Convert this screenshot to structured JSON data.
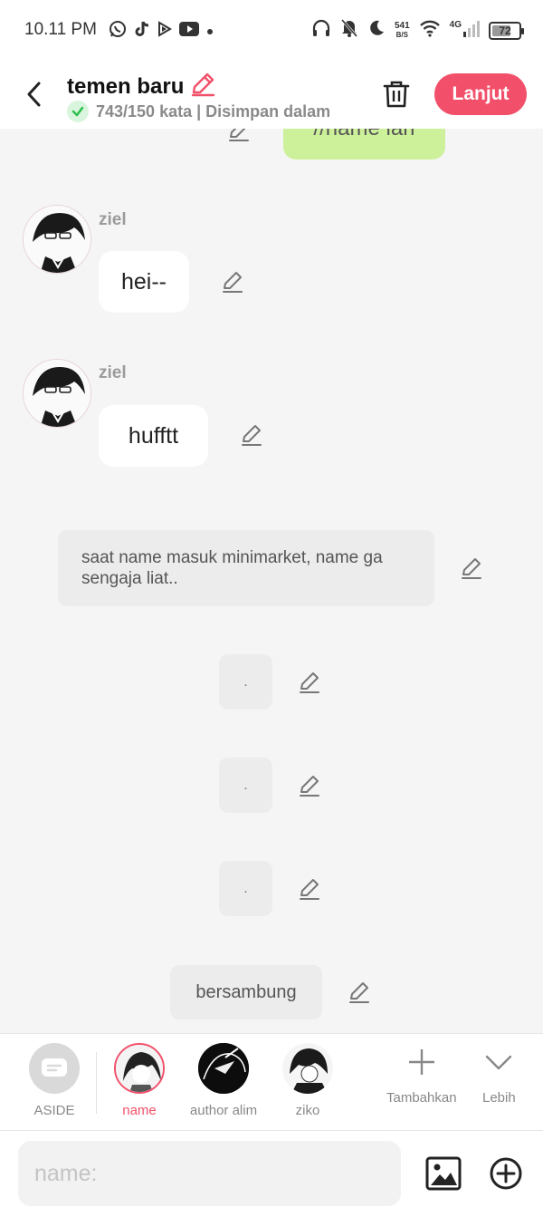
{
  "status_bar": {
    "time": "10.11 PM",
    "net_speed_value": "541",
    "net_speed_unit": "B/S",
    "network": "4G",
    "battery": "72",
    "battery_level": 0.72
  },
  "header": {
    "back_icon": "back-arrow-icon",
    "title": "temen baru",
    "subtitle": "743/150 kata | Disimpan dalam",
    "next_label": "Lanjut",
    "accent_color": "#f2506a"
  },
  "chat": {
    "top_message": "//name lari",
    "messages": [
      {
        "sender": "ziel",
        "text": "hei--"
      },
      {
        "sender": "ziel",
        "text": "hufftt"
      }
    ],
    "narration": "saat name masuk minimarket, name ga sengaja liat..",
    "dots": [
      ".",
      ".",
      "."
    ],
    "ending": "bersambung"
  },
  "characters": [
    {
      "label": "ASIDE",
      "icon": "aside-icon"
    },
    {
      "label": "name",
      "active": true
    },
    {
      "label": "author alim"
    },
    {
      "label": "ziko"
    }
  ],
  "tools": {
    "add_label": "Tambahkan",
    "more_label": "Lebih"
  },
  "input": {
    "placeholder": "name:"
  }
}
